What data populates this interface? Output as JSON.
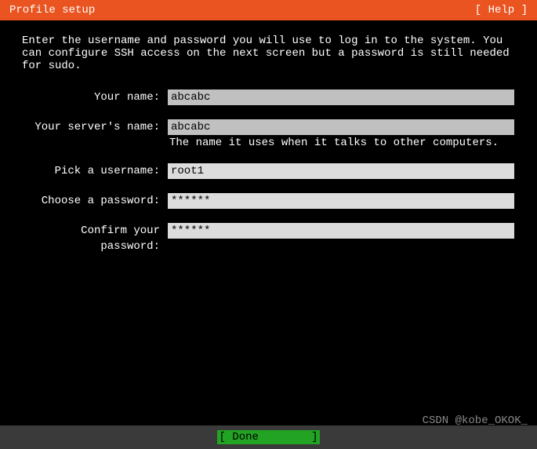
{
  "titlebar": {
    "title": "Profile setup",
    "help": "[ Help ]"
  },
  "intro": "Enter the username and password you will use to log in to the system. You can configure SSH access on the next screen but a password is still needed for sudo.",
  "fields": {
    "name": {
      "label": "Your name:",
      "value": "abcabc"
    },
    "server": {
      "label": "Your server's name:",
      "value": "abcabc",
      "hint": "The name it uses when it talks to other computers."
    },
    "username": {
      "label": "Pick a username:",
      "value": "root1"
    },
    "password": {
      "label": "Choose a password:",
      "value": "******"
    },
    "confirm": {
      "label": "Confirm your password:",
      "value": "******"
    }
  },
  "footer": {
    "done": "[ Done        ]"
  },
  "watermark": "CSDN @kobe_OKOK_"
}
